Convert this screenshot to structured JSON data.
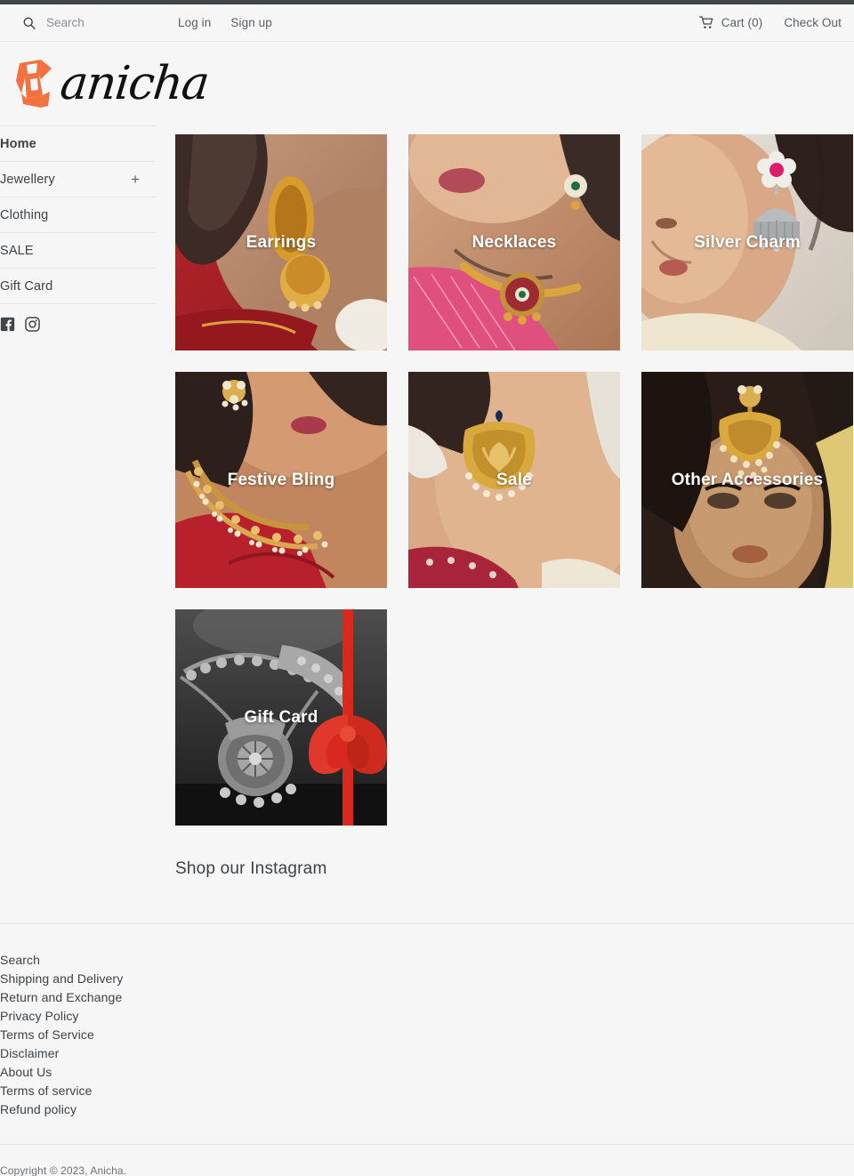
{
  "utility_bar": {
    "search_placeholder": "Search",
    "search_value": "",
    "search_icon": "search-icon",
    "login_label": "Log in",
    "signup_label": "Sign up",
    "cart_icon": "shopping-cart-icon",
    "cart_label": "Cart (0)",
    "checkout_label": "Check Out"
  },
  "brand": {
    "logo_word": "anicha",
    "logo_mark": "anicha-butterfly-mark",
    "accent_color": "#f2713f"
  },
  "sidebar": {
    "items": [
      {
        "label": "Home",
        "active": true,
        "expandable": false
      },
      {
        "label": "Jewellery",
        "active": false,
        "expandable": true,
        "expand_icon": "plus-icon"
      },
      {
        "label": "Clothing",
        "active": false,
        "expandable": false
      },
      {
        "label": "SALE",
        "active": false,
        "expandable": false
      },
      {
        "label": "Gift Card",
        "active": false,
        "expandable": false
      }
    ],
    "social": [
      {
        "name": "facebook-icon",
        "label": "Facebook"
      },
      {
        "name": "instagram-icon",
        "label": "Instagram"
      }
    ]
  },
  "main": {
    "collections": [
      {
        "label": "Earrings",
        "image": "gold-ear-cuff-jhumka-on-ear"
      },
      {
        "label": "Necklaces",
        "image": "gold-choker-necklace-on-neck"
      },
      {
        "label": "Silver Charm",
        "image": "silver-jhumka-earring-profile"
      },
      {
        "label": "Festive Bling",
        "image": "gold-pearl-necklace-red-saree"
      },
      {
        "label": "Sale",
        "image": "gold-lotus-chandbali-earring"
      },
      {
        "label": "Other Accessories",
        "image": "gold-maang-tikka-headpiece"
      },
      {
        "label": "Gift Card",
        "image": "silver-necklace-bw-red-ribbon"
      }
    ],
    "instagram_heading": "Shop our Instagram"
  },
  "footer": {
    "links": [
      "Search",
      "Shipping and Delivery",
      "Return and Exchange",
      "Privacy Policy",
      "Terms of Service",
      "Disclaimer",
      "About Us",
      "Terms of service",
      "Refund policy"
    ],
    "copyright": "Copyright © 2023, Anicha."
  },
  "colors": {
    "page_bg": "#f6f6f6",
    "top_strip": "#41464b",
    "text": "#3d4246",
    "muted_text": "#6c7278",
    "border": "#e6e6e6",
    "brand_orange": "#f2713f",
    "ribbon_red": "#d8281f"
  }
}
